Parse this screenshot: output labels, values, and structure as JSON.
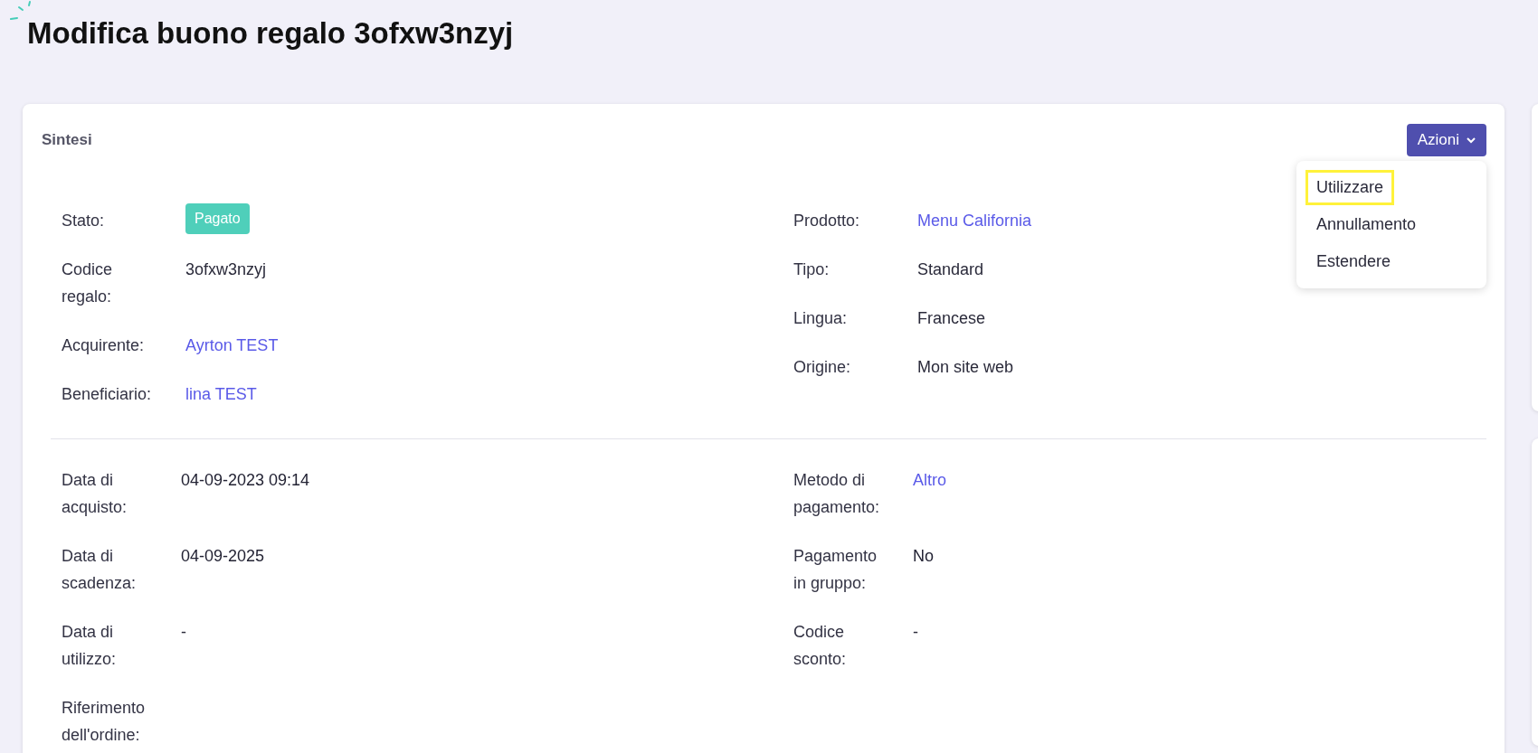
{
  "page": {
    "title": "Modifica buono regalo 3ofxw3nzyj"
  },
  "card": {
    "title": "Sintesi",
    "actions_button": {
      "label": "Azioni"
    },
    "actions_menu": [
      {
        "label": "Utilizzare",
        "highlighted": true
      },
      {
        "label": "Annullamento",
        "highlighted": false
      },
      {
        "label": "Estendere",
        "highlighted": false
      }
    ],
    "sections": [
      {
        "left": [
          {
            "label": "Stato:",
            "value": "Pagato",
            "kind": "badge"
          },
          {
            "label": "Codice regalo:",
            "value": "3ofxw3nzyj",
            "kind": "text"
          },
          {
            "label": "Acquirente:",
            "value": "Ayrton TEST",
            "kind": "link"
          },
          {
            "label": "Beneficiario:",
            "value": "lina TEST",
            "kind": "link"
          }
        ],
        "right": [
          {
            "label": "Prodotto:",
            "value": "Menu California",
            "kind": "link"
          },
          {
            "label": "Tipo:",
            "value": "Standard",
            "kind": "text"
          },
          {
            "label": "Lingua:",
            "value": "Francese",
            "kind": "text"
          },
          {
            "label": "Origine:",
            "value": "Mon site web",
            "kind": "text"
          }
        ]
      },
      {
        "left": [
          {
            "label": "Data di acquisto:",
            "value": "04-09-2023 09:14",
            "kind": "strong"
          },
          {
            "label": "Data di scadenza:",
            "value": "04-09-2025",
            "kind": "strong"
          },
          {
            "label": "Data di utilizzo:",
            "value": "-",
            "kind": "text"
          },
          {
            "label": "Riferimento dell'ordine:"
          }
        ],
        "right": [
          {
            "label": "Metodo di pagamento:",
            "value": "Altro",
            "kind": "link"
          },
          {
            "label": "Pagamento in gruppo:",
            "value": "No",
            "kind": "strong"
          },
          {
            "label": "Codice sconto:",
            "value": "-",
            "kind": "text"
          }
        ]
      }
    ]
  }
}
